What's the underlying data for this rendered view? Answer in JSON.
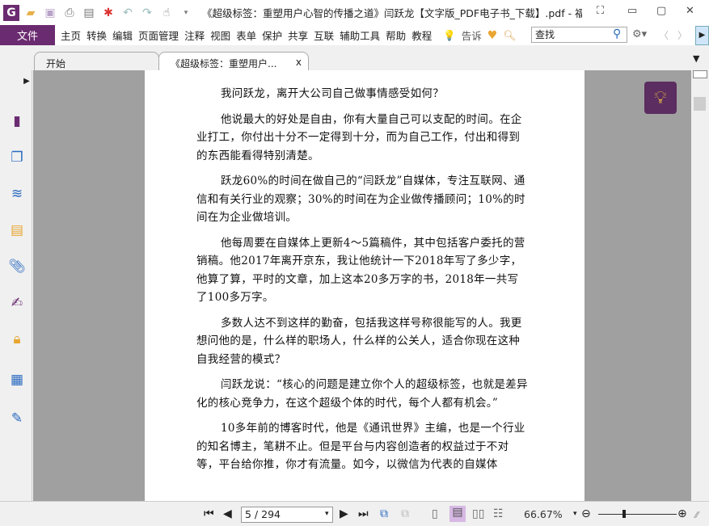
{
  "window": {
    "title": "《超级标签：重塑用户心智的传播之道》闫跃龙【文字版_PDF电子书_下载】.pdf - 福..."
  },
  "menu": {
    "file": "文件",
    "items": [
      "主页",
      "转换",
      "编辑",
      "页面管理",
      "注释",
      "视图",
      "表单",
      "保护",
      "共享",
      "互联",
      "辅助工具",
      "帮助",
      "教程"
    ],
    "tell": "告诉",
    "search_placeholder": "查找"
  },
  "tabs": [
    {
      "label": "开始"
    },
    {
      "label": "《超级标签：重塑用户...",
      "close": "x"
    }
  ],
  "page": {
    "paragraphs": [
      "我问跃龙，离开大公司自己做事情感受如何？",
      "他说最大的好处是自由，你有大量自己可以支配的时间。在企业打工，你付出十分不一定得到十分，而为自己工作，付出和得到的东西能看得特别清楚。",
      "跃龙60%的时间在做自己的“闫跃龙”自媒体，专注互联网、通信和有关行业的观察；30%的时间在为企业做传播顾问；10%的时间在为企业做培训。",
      "他每周要在自媒体上更新4～5篇稿件，其中包括客户委托的营销稿。他2017年离开京东，我让他统计一下2018年写了多少字，他算了算，平时的文章，加上这本20多万字的书，2018年一共写了100多万字。",
      "多数人达不到这样的勤奋，包括我这样号称很能写的人。我更想问他的是，什么样的职场人，什么样的公关人，适合你现在这种自我经营的模式？",
      "闫跃龙说：“核心的问题是建立你个人的超级标签，也就是差异化的核心竞争力，在这个超级个体的时代，每个人都有机会。”",
      "10多年前的博客时代，他是《通讯世界》主编，也是一个行业的知名博主，笔耕不止。但是平台与内容创造者的权益过于不对等，平台给你推，你才有流量。如今，以微信为代表的自媒体"
    ]
  },
  "status": {
    "page_field": "5 / 294",
    "zoom": "66.67%"
  },
  "colors": {
    "accent": "#6b2b70",
    "canvas": "#a0a0a0"
  }
}
